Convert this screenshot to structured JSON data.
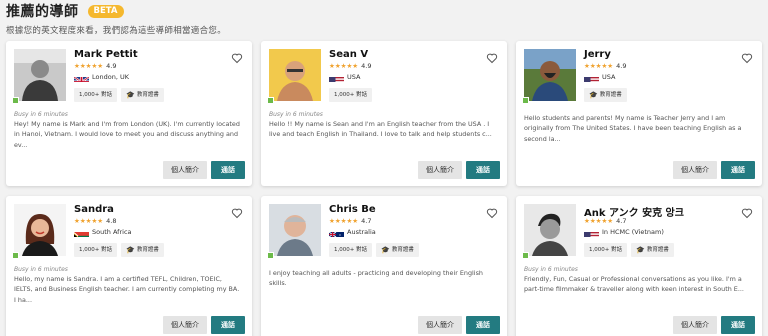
{
  "header": {
    "title": "推薦的導師",
    "badge": "BETA",
    "subtitle": "根據您的英文程度來看，我們認為這些導師相當適合您。"
  },
  "colors": {
    "accent": "#237b81",
    "star": "#f0a22e",
    "online": "#6cba4a",
    "beta": "#f5b82e"
  },
  "tutors": [
    {
      "name": "Mark Pettit",
      "stars": "★★★★★",
      "rating": "4.9",
      "flag_icon": "uk-flag-icon",
      "location": "London, UK",
      "lessons": "1,000+ 對話",
      "cert": "教育證書",
      "busy": "Busy in 6 minutes",
      "bio": "Hey! My name is Mark and I'm from London (UK). I'm currently located in Hanoi, Vietnam. I would love to meet you and discuss anything and ev...",
      "profile_label": "個人簡介",
      "call_label": "通話"
    },
    {
      "name": "Sean V",
      "stars": "★★★★★",
      "rating": "4.9",
      "flag_icon": "usa-flag-icon",
      "location": "USA",
      "lessons": "1,000+ 對話",
      "cert": "",
      "busy": "Busy in 6 minutes",
      "bio": "Hello !! My name is Sean and I'm an English teacher from the USA . I live and teach English in Thailand. I love to talk and help students c...",
      "profile_label": "個人簡介",
      "call_label": "通話"
    },
    {
      "name": "Jerry",
      "stars": "★★★★★",
      "rating": "4.9",
      "flag_icon": "usa-flag-icon",
      "location": "USA",
      "lessons": "",
      "cert": "教育證書",
      "busy": "",
      "bio": "Hello students and parents! My name is Teacher Jerry and I am originally from The United States. I have been teaching English as a second la...",
      "profile_label": "個人簡介",
      "call_label": "通話"
    },
    {
      "name": "Sandra",
      "stars": "★★★★★",
      "rating": "4.8",
      "flag_icon": "south-africa-flag-icon",
      "location": "South Africa",
      "lessons": "1,000+ 對話",
      "cert": "教育證書",
      "busy": "Busy in 6 minutes",
      "bio": "Hello, my name is Sandra. I am a certified TEFL, Children, TOEIC, IELTS, and Business English teacher. I am currently completing my BA. I ha...",
      "profile_label": "個人簡介",
      "call_label": "通話"
    },
    {
      "name": "Chris Be",
      "stars": "★★★★★",
      "rating": "4.7",
      "flag_icon": "australia-flag-icon",
      "location": "Australia",
      "lessons": "1,000+ 對話",
      "cert": "教育證書",
      "busy": "",
      "bio": "I enjoy teaching all adults - practicing and developing their English skills.",
      "profile_label": "個人簡介",
      "call_label": "通話"
    },
    {
      "name": "Ank アンク 安克 앙크",
      "stars": "★★★★★",
      "rating": "4.7",
      "flag_icon": "usa-flag-icon",
      "location": "In HCMC (Vietnam)",
      "lessons": "1,000+ 對話",
      "cert": "教育證書",
      "busy": "Busy in 6 minutes",
      "bio": "Friendly, Fun, Casual or Professional conversations as you like. I'm a part-time filmmaker & traveller along with keen interest in South E...",
      "profile_label": "個人簡介",
      "call_label": "通話"
    }
  ]
}
